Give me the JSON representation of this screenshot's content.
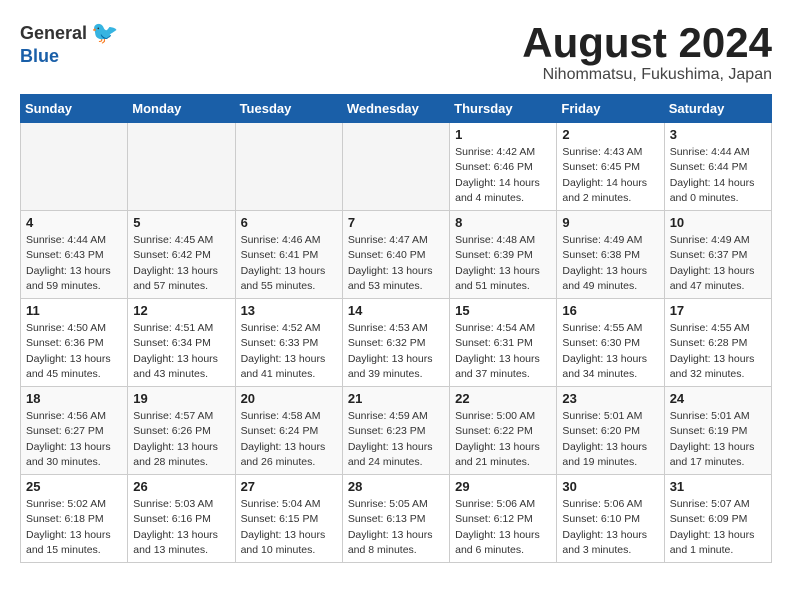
{
  "header": {
    "logo_general": "General",
    "logo_blue": "Blue",
    "month_title": "August 2024",
    "location": "Nihommatsu, Fukushima, Japan"
  },
  "weekdays": [
    "Sunday",
    "Monday",
    "Tuesday",
    "Wednesday",
    "Thursday",
    "Friday",
    "Saturday"
  ],
  "weeks": [
    [
      {
        "day": "",
        "info": ""
      },
      {
        "day": "",
        "info": ""
      },
      {
        "day": "",
        "info": ""
      },
      {
        "day": "",
        "info": ""
      },
      {
        "day": "1",
        "info": "Sunrise: 4:42 AM\nSunset: 6:46 PM\nDaylight: 14 hours\nand 4 minutes."
      },
      {
        "day": "2",
        "info": "Sunrise: 4:43 AM\nSunset: 6:45 PM\nDaylight: 14 hours\nand 2 minutes."
      },
      {
        "day": "3",
        "info": "Sunrise: 4:44 AM\nSunset: 6:44 PM\nDaylight: 14 hours\nand 0 minutes."
      }
    ],
    [
      {
        "day": "4",
        "info": "Sunrise: 4:44 AM\nSunset: 6:43 PM\nDaylight: 13 hours\nand 59 minutes."
      },
      {
        "day": "5",
        "info": "Sunrise: 4:45 AM\nSunset: 6:42 PM\nDaylight: 13 hours\nand 57 minutes."
      },
      {
        "day": "6",
        "info": "Sunrise: 4:46 AM\nSunset: 6:41 PM\nDaylight: 13 hours\nand 55 minutes."
      },
      {
        "day": "7",
        "info": "Sunrise: 4:47 AM\nSunset: 6:40 PM\nDaylight: 13 hours\nand 53 minutes."
      },
      {
        "day": "8",
        "info": "Sunrise: 4:48 AM\nSunset: 6:39 PM\nDaylight: 13 hours\nand 51 minutes."
      },
      {
        "day": "9",
        "info": "Sunrise: 4:49 AM\nSunset: 6:38 PM\nDaylight: 13 hours\nand 49 minutes."
      },
      {
        "day": "10",
        "info": "Sunrise: 4:49 AM\nSunset: 6:37 PM\nDaylight: 13 hours\nand 47 minutes."
      }
    ],
    [
      {
        "day": "11",
        "info": "Sunrise: 4:50 AM\nSunset: 6:36 PM\nDaylight: 13 hours\nand 45 minutes."
      },
      {
        "day": "12",
        "info": "Sunrise: 4:51 AM\nSunset: 6:34 PM\nDaylight: 13 hours\nand 43 minutes."
      },
      {
        "day": "13",
        "info": "Sunrise: 4:52 AM\nSunset: 6:33 PM\nDaylight: 13 hours\nand 41 minutes."
      },
      {
        "day": "14",
        "info": "Sunrise: 4:53 AM\nSunset: 6:32 PM\nDaylight: 13 hours\nand 39 minutes."
      },
      {
        "day": "15",
        "info": "Sunrise: 4:54 AM\nSunset: 6:31 PM\nDaylight: 13 hours\nand 37 minutes."
      },
      {
        "day": "16",
        "info": "Sunrise: 4:55 AM\nSunset: 6:30 PM\nDaylight: 13 hours\nand 34 minutes."
      },
      {
        "day": "17",
        "info": "Sunrise: 4:55 AM\nSunset: 6:28 PM\nDaylight: 13 hours\nand 32 minutes."
      }
    ],
    [
      {
        "day": "18",
        "info": "Sunrise: 4:56 AM\nSunset: 6:27 PM\nDaylight: 13 hours\nand 30 minutes."
      },
      {
        "day": "19",
        "info": "Sunrise: 4:57 AM\nSunset: 6:26 PM\nDaylight: 13 hours\nand 28 minutes."
      },
      {
        "day": "20",
        "info": "Sunrise: 4:58 AM\nSunset: 6:24 PM\nDaylight: 13 hours\nand 26 minutes."
      },
      {
        "day": "21",
        "info": "Sunrise: 4:59 AM\nSunset: 6:23 PM\nDaylight: 13 hours\nand 24 minutes."
      },
      {
        "day": "22",
        "info": "Sunrise: 5:00 AM\nSunset: 6:22 PM\nDaylight: 13 hours\nand 21 minutes."
      },
      {
        "day": "23",
        "info": "Sunrise: 5:01 AM\nSunset: 6:20 PM\nDaylight: 13 hours\nand 19 minutes."
      },
      {
        "day": "24",
        "info": "Sunrise: 5:01 AM\nSunset: 6:19 PM\nDaylight: 13 hours\nand 17 minutes."
      }
    ],
    [
      {
        "day": "25",
        "info": "Sunrise: 5:02 AM\nSunset: 6:18 PM\nDaylight: 13 hours\nand 15 minutes."
      },
      {
        "day": "26",
        "info": "Sunrise: 5:03 AM\nSunset: 6:16 PM\nDaylight: 13 hours\nand 13 minutes."
      },
      {
        "day": "27",
        "info": "Sunrise: 5:04 AM\nSunset: 6:15 PM\nDaylight: 13 hours\nand 10 minutes."
      },
      {
        "day": "28",
        "info": "Sunrise: 5:05 AM\nSunset: 6:13 PM\nDaylight: 13 hours\nand 8 minutes."
      },
      {
        "day": "29",
        "info": "Sunrise: 5:06 AM\nSunset: 6:12 PM\nDaylight: 13 hours\nand 6 minutes."
      },
      {
        "day": "30",
        "info": "Sunrise: 5:06 AM\nSunset: 6:10 PM\nDaylight: 13 hours\nand 3 minutes."
      },
      {
        "day": "31",
        "info": "Sunrise: 5:07 AM\nSunset: 6:09 PM\nDaylight: 13 hours\nand 1 minute."
      }
    ]
  ]
}
